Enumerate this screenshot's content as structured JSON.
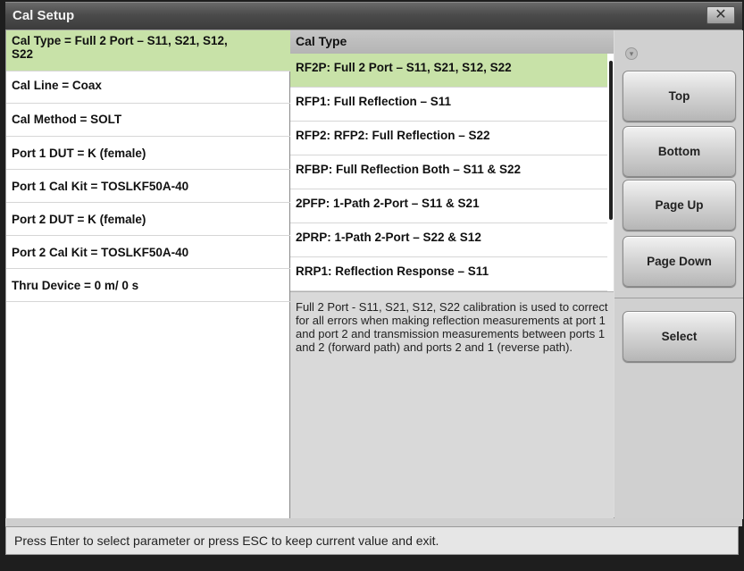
{
  "window": {
    "title": "Cal Setup",
    "close_glyph": "✕"
  },
  "params": [
    {
      "label_line1": "Cal Type = Full 2 Port – S11, S21, S12,",
      "label_line2": "S22",
      "selected": true
    },
    {
      "label_line1": "Cal Line = Coax",
      "label_line2": "",
      "selected": false
    },
    {
      "label_line1": "Cal Method = SOLT",
      "label_line2": "",
      "selected": false
    },
    {
      "label_line1": "Port 1 DUT = K (female)",
      "label_line2": "",
      "selected": false
    },
    {
      "label_line1": "Port 1 Cal Kit = TOSLKF50A-40",
      "label_line2": "",
      "selected": false
    },
    {
      "label_line1": "Port 2 DUT = K (female)",
      "label_line2": "",
      "selected": false
    },
    {
      "label_line1": "Port 2 Cal Kit = TOSLKF50A-40",
      "label_line2": "",
      "selected": false
    },
    {
      "label_line1": "Thru Device = 0 m/ 0 s",
      "label_line2": "",
      "selected": false
    }
  ],
  "list": {
    "header": "Cal Type",
    "items": [
      {
        "label": "RF2P: Full 2 Port – S11, S21, S12, S22",
        "selected": true
      },
      {
        "label": "RFP1: Full Reflection – S11",
        "selected": false
      },
      {
        "label": "RFP2: RFP2: Full Reflection – S22",
        "selected": false
      },
      {
        "label": "RFBP: Full Reflection Both – S11 & S22",
        "selected": false
      },
      {
        "label": "2PFP: 1-Path 2-Port – S11 & S21",
        "selected": false
      },
      {
        "label": "2PRP: 1-Path 2-Port – S22 & S12",
        "selected": false
      },
      {
        "label": "RRP1: Reflection Response – S11",
        "selected": false
      }
    ],
    "description": "Full 2 Port - S11, S21, S12, S22 calibration is used to correct for all errors when making reflection measurements at port 1 and port 2 and transmission measurements between ports 1 and 2 (forward path) and ports 2 and 1 (reverse path)."
  },
  "buttons": {
    "top": "Top",
    "bottom": "Bottom",
    "page_up": "Page Up",
    "page_down": "Page Down",
    "select": "Select",
    "up_indicator_glyph": "▾"
  },
  "status": {
    "text": "Press Enter to select parameter or press ESC to keep current value and exit."
  },
  "colors": {
    "selected_row": "#c8e2a8",
    "title_bar": "#4b4b4b"
  }
}
